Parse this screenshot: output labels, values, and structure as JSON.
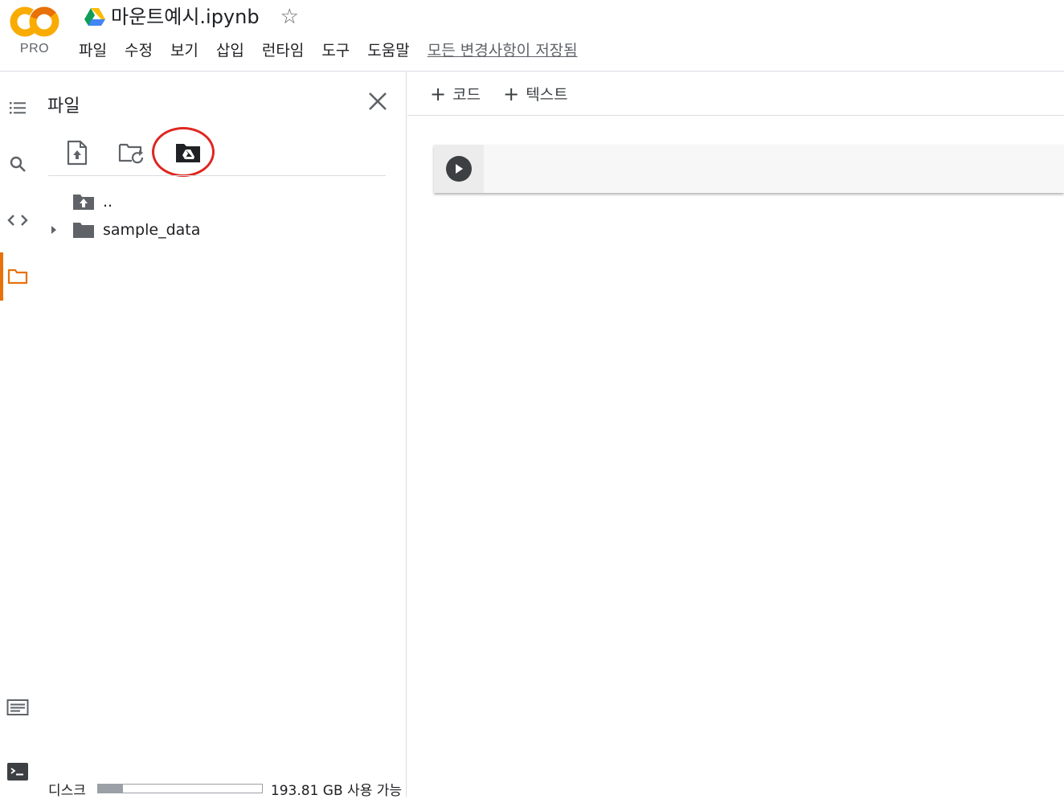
{
  "header": {
    "logo_text": "CO",
    "logo_sub": "PRO",
    "doc_title": "마운트예시.ipynb",
    "star_glyph": "☆",
    "menu": [
      "파일",
      "수정",
      "보기",
      "삽입",
      "런타임",
      "도구",
      "도움말"
    ],
    "save_status": "모든 변경사항이 저장됨"
  },
  "rail": {
    "items": [
      "toc-icon",
      "search-icon",
      "code-snippets-icon",
      "folder-icon"
    ],
    "bottom_items": [
      "command-palette-icon",
      "terminal-icon"
    ],
    "active": "folder-icon"
  },
  "panel": {
    "title": "파일",
    "tools": [
      "upload-file-icon",
      "refresh-folder-icon",
      "mount-drive-icon"
    ],
    "tree": [
      {
        "label": "..",
        "icon": "folder-up-icon",
        "expandable": false
      },
      {
        "label": "sample_data",
        "icon": "folder-icon",
        "expandable": true
      }
    ],
    "disk": {
      "label": "디스크",
      "usage_fraction": 0.15,
      "text": "193.81 GB 사용 가능"
    }
  },
  "toolbar": {
    "add_code": "코드",
    "add_text": "텍스트"
  },
  "colors": {
    "accent": "#e8710a",
    "highlight_ring": "#e0261f",
    "logo_orange": "#f9ab00",
    "logo_deep": "#e8710a"
  }
}
